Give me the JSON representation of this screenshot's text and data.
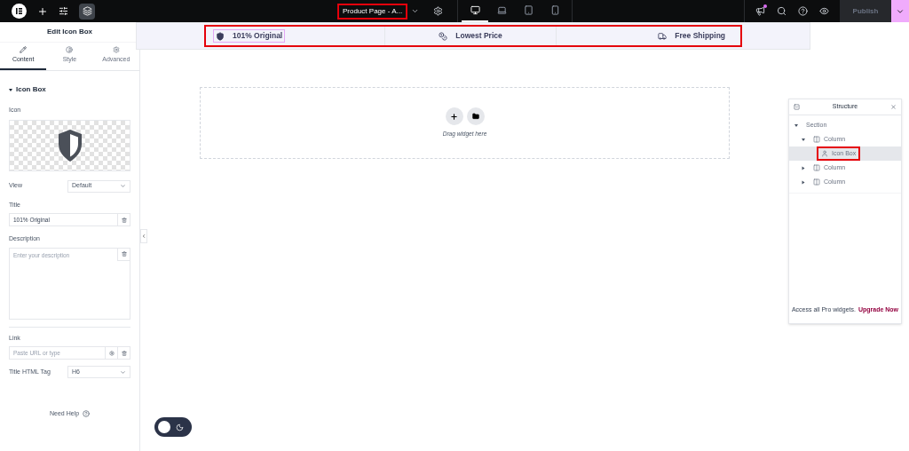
{
  "topbar": {
    "document_title": {
      "text": "Product Page - A...",
      "highlighted": true
    },
    "devices": [
      {
        "kind": "desktop",
        "selected": true
      },
      {
        "kind": "laptop",
        "selected": false
      },
      {
        "kind": "tablet",
        "selected": false
      },
      {
        "kind": "mobile",
        "selected": false
      }
    ],
    "notification": true,
    "publish": {
      "label": "Publish",
      "disabled": true
    }
  },
  "panel": {
    "title": "Edit Icon Box",
    "tabs": [
      {
        "label": "Content",
        "kind": "pencil",
        "selected": true
      },
      {
        "label": "Style",
        "kind": "contrast",
        "selected": false
      },
      {
        "label": "Advanced",
        "kind": "gear",
        "selected": false
      }
    ],
    "section": {
      "title": "Icon Box",
      "expanded": true
    },
    "icon_label": "Icon",
    "view": {
      "label": "View",
      "value": "Default"
    },
    "title_field": {
      "label": "Title",
      "value": "101% Original"
    },
    "description": {
      "label": "Description",
      "placeholder": "Enter your description"
    },
    "link": {
      "label": "Link",
      "placeholder": "Paste URL or type"
    },
    "html_tag": {
      "label": "Title HTML Tag",
      "value": "H6"
    },
    "help": "Need Help"
  },
  "canvas": {
    "features": {
      "highlighted": true,
      "items": [
        {
          "kind": "shield",
          "label": "101% Original",
          "selected": true
        },
        {
          "kind": "coins",
          "label": "Lowest Price",
          "selected": false
        },
        {
          "kind": "truck",
          "label": "Free Shipping",
          "selected": false
        }
      ]
    },
    "drop_zone": {
      "hint": "Drag widget here"
    },
    "dark_mode": false
  },
  "structure": {
    "title": "Structure",
    "tree": [
      {
        "label": "Section",
        "expanded": true,
        "selected": false,
        "highlighted": false,
        "children": [
          {
            "label": "Column",
            "kind": "column",
            "expanded": true,
            "selected": false,
            "highlighted": false,
            "children": [
              {
                "label": "Icon Box",
                "kind": "widget",
                "selected": true,
                "highlighted": true
              }
            ]
          },
          {
            "label": "Column",
            "kind": "column",
            "expanded": false,
            "selected": false,
            "highlighted": false
          },
          {
            "label": "Column",
            "kind": "column",
            "expanded": false,
            "selected": false,
            "highlighted": false
          }
        ]
      }
    ],
    "promo": "Access all Pro widgets.",
    "promo_link": "Upgrade Now"
  }
}
